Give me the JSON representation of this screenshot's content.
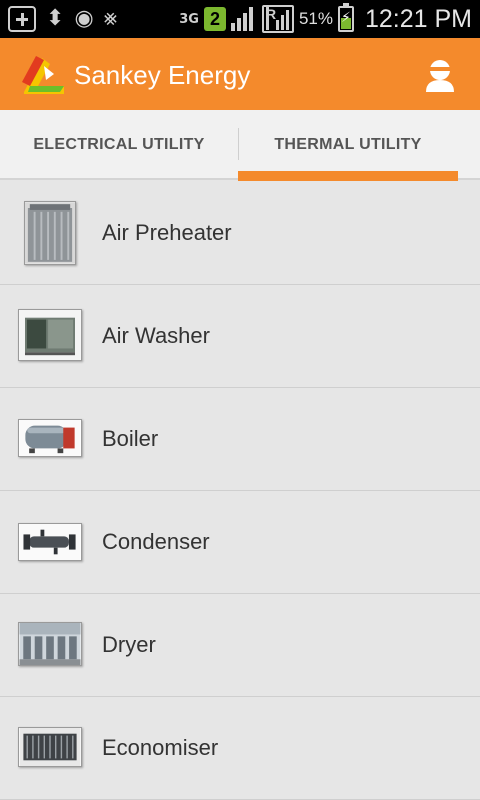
{
  "status_bar": {
    "time": "12:21 PM",
    "battery_percent": "51%",
    "network_type": "3G",
    "notification_badge": "2",
    "roaming_indicator": "R",
    "icons": [
      "plus-icon",
      "usb-icon",
      "eye-icon",
      "no-signal-icon",
      "3g-icon",
      "notification-badge-icon",
      "signal-icon",
      "roaming-signal-icon",
      "battery-charging-icon"
    ]
  },
  "action_bar": {
    "title": "Sankey Energy",
    "logo_icon": "sankey-logo-icon",
    "user_icon": "user-icon",
    "accent_color": "#f48a2c"
  },
  "tabs": [
    {
      "label": "ELECTRICAL UTILITY",
      "selected": false
    },
    {
      "label": "THERMAL UTILITY",
      "selected": true
    }
  ],
  "items": [
    {
      "label": "Air Preheater",
      "icon": "air-preheater-image"
    },
    {
      "label": "Air Washer",
      "icon": "air-washer-image"
    },
    {
      "label": "Boiler",
      "icon": "boiler-image"
    },
    {
      "label": "Condenser",
      "icon": "condenser-image"
    },
    {
      "label": "Dryer",
      "icon": "dryer-image"
    },
    {
      "label": "Economiser",
      "icon": "economiser-image"
    }
  ]
}
